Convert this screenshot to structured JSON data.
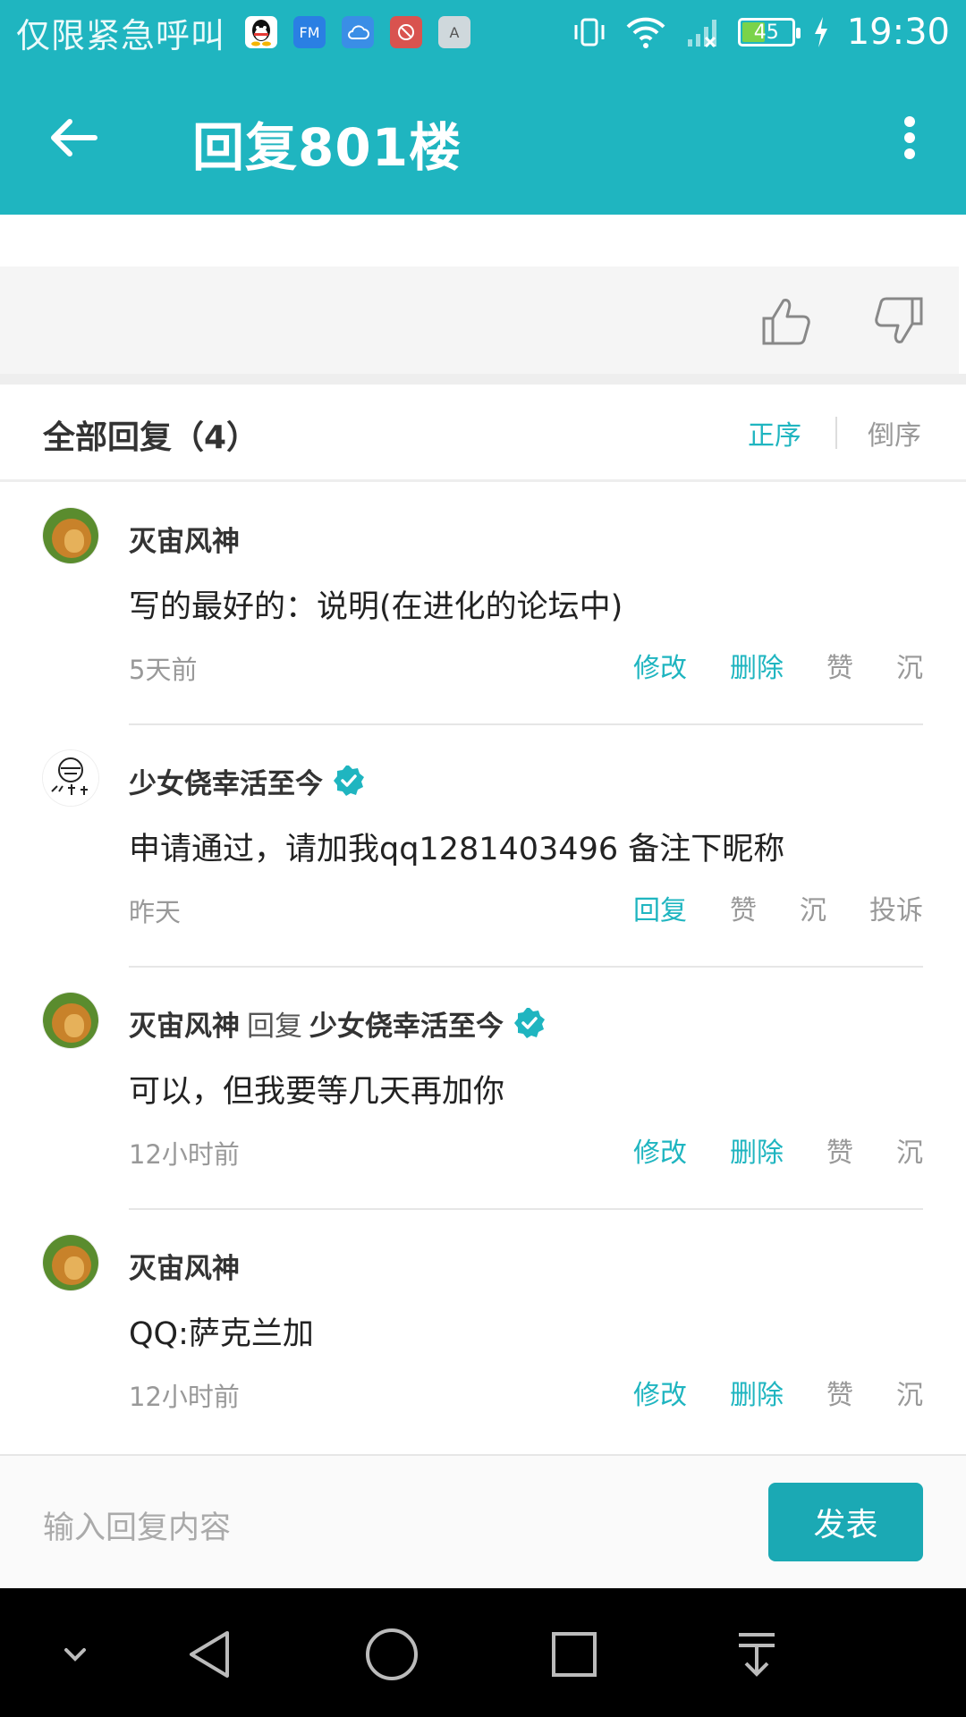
{
  "status_bar": {
    "emergency_text": "仅限紧急呼叫",
    "apps": [
      {
        "icon": "qq-icon",
        "color": "#ffffff",
        "label": ""
      },
      {
        "icon": "fm-app-icon",
        "color": "#2a7fe3",
        "label": "FM"
      },
      {
        "icon": "cloud-app-icon",
        "color": "#3a8ee6",
        "label": ""
      },
      {
        "icon": "tool-app-icon",
        "color": "#d9534f",
        "label": ""
      },
      {
        "icon": "text-app-icon",
        "color": "#cfd8dc",
        "label": "A"
      }
    ],
    "battery": "45",
    "time": "19:30"
  },
  "appbar": {
    "title": "回复801楼"
  },
  "replies_header": {
    "title": "全部回复（4）",
    "sort_asc": "正序",
    "sort_desc": "倒序"
  },
  "replies": [
    {
      "author": "灭宙风神",
      "reply_word": "",
      "reply_to": "",
      "content": "写的最好的：说明(在进化的论坛中)",
      "time": "5天前",
      "actions": [
        "修改",
        "删除",
        "赞",
        "沉"
      ]
    },
    {
      "author": "少女侥幸活至今",
      "reply_word": "",
      "reply_to": "",
      "content": "申请通过，请加我qq1281403496 备注下昵称",
      "time": "昨天",
      "actions": [
        "回复",
        "赞",
        "沉",
        "投诉"
      ]
    },
    {
      "author": "灭宙风神",
      "reply_word": "回复",
      "reply_to": "少女侥幸活至今",
      "content": "可以，但我要等几天再加你",
      "time": "12小时前",
      "actions": [
        "修改",
        "删除",
        "赞",
        "沉"
      ]
    },
    {
      "author": "灭宙风神",
      "reply_word": "",
      "reply_to": "",
      "content": "QQ:萨克兰加",
      "time": "12小时前",
      "actions": [
        "修改",
        "删除",
        "赞",
        "沉"
      ]
    }
  ],
  "input_bar": {
    "placeholder": "输入回复内容",
    "publish": "发表"
  },
  "colors": {
    "accent": "#1fb5c0",
    "muted": "#999999"
  }
}
